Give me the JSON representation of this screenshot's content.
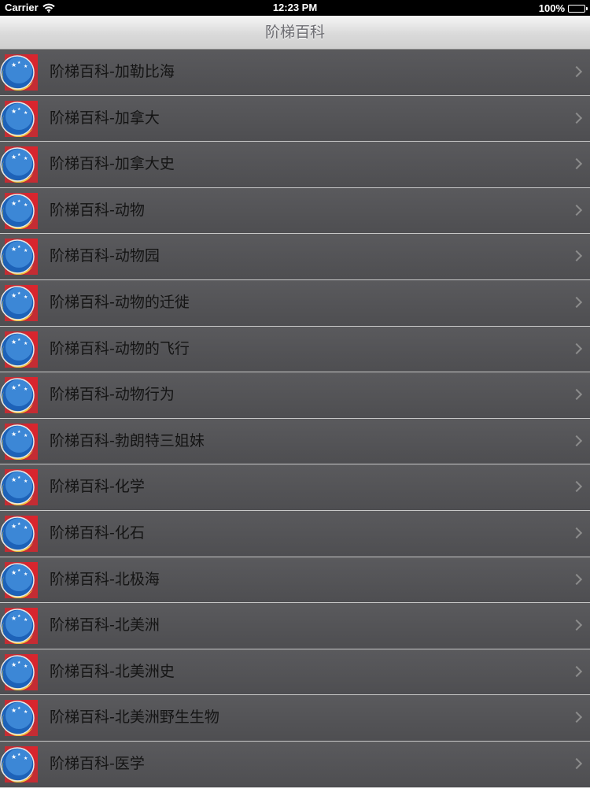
{
  "status_bar": {
    "carrier": "Carrier",
    "time": "12:23 PM",
    "battery": "100%",
    "battery_level": 1.0
  },
  "nav": {
    "title": "阶梯百科"
  },
  "colors": {
    "row_background": "#545457",
    "separator": "#c9c9c9",
    "row_text": "#141414",
    "nav_title": "#6d6d72",
    "icon_red": "#d8262e",
    "icon_blue": "#1d62b8",
    "icon_moon": "#f2c63a"
  },
  "icons": {
    "row_icon": "crescent-moon-stars-icon",
    "chevron": "chevron-right-icon",
    "wifi": "wifi-icon",
    "battery": "battery-icon"
  },
  "items": [
    {
      "label": "阶梯百科-加勒比海"
    },
    {
      "label": "阶梯百科-加拿大"
    },
    {
      "label": "阶梯百科-加拿大史"
    },
    {
      "label": "阶梯百科-动物"
    },
    {
      "label": "阶梯百科-动物园"
    },
    {
      "label": "阶梯百科-动物的迁徙"
    },
    {
      "label": "阶梯百科-动物的飞行"
    },
    {
      "label": "阶梯百科-动物行为"
    },
    {
      "label": "阶梯百科-勃朗特三姐妹"
    },
    {
      "label": "阶梯百科-化学"
    },
    {
      "label": "阶梯百科-化石"
    },
    {
      "label": "阶梯百科-北极海"
    },
    {
      "label": "阶梯百科-北美洲"
    },
    {
      "label": "阶梯百科-北美洲史"
    },
    {
      "label": "阶梯百科-北美洲野生生物"
    },
    {
      "label": "阶梯百科-医学"
    }
  ]
}
